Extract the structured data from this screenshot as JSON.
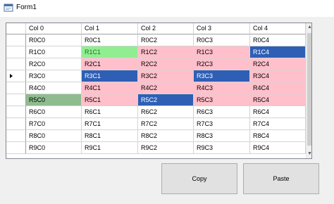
{
  "window": {
    "title": "Form1",
    "icon": "winforms-app-icon"
  },
  "grid": {
    "columns": [
      "Col 0",
      "Col 1",
      "Col 2",
      "Col 3",
      "Col 4"
    ],
    "current_row_indicator": "row-pointer-arrow",
    "current_row_index": 3,
    "rows": [
      [
        "R0C0",
        "R0C1",
        "R0C2",
        "R0C3",
        "R0C4"
      ],
      [
        "R1C0",
        "R1C1",
        "R1C2",
        "R1C3",
        "R1C4"
      ],
      [
        "R2C0",
        "R2C1",
        "R2C2",
        "R2C3",
        "R2C4"
      ],
      [
        "R3C0",
        "R3C1",
        "R3C2",
        "R3C3",
        "R3C4"
      ],
      [
        "R4C0",
        "R4C1",
        "R4C2",
        "R4C3",
        "R4C4"
      ],
      [
        "R5C0",
        "R5C1",
        "R5C2",
        "R5C3",
        "R5C4"
      ],
      [
        "R6C0",
        "R6C1",
        "R6C2",
        "R6C3",
        "R6C4"
      ],
      [
        "R7C0",
        "R7C1",
        "R7C2",
        "R7C3",
        "R7C4"
      ],
      [
        "R8C0",
        "R8C1",
        "R8C2",
        "R8C3",
        "R8C4"
      ],
      [
        "R9C0",
        "R9C1",
        "R9C2",
        "R9C3",
        "R9C4"
      ]
    ],
    "cell_colors": [
      [
        "white",
        "white",
        "white",
        "white",
        "white"
      ],
      [
        "white",
        "green",
        "pink",
        "pink",
        "blue"
      ],
      [
        "white",
        "pink",
        "pink",
        "pink",
        "pink"
      ],
      [
        "white",
        "blue",
        "pink",
        "blue",
        "pink"
      ],
      [
        "white",
        "pink",
        "pink",
        "pink",
        "pink"
      ],
      [
        "dkgreen",
        "pink",
        "blue",
        "pink",
        "pink"
      ],
      [
        "white",
        "white",
        "white",
        "white",
        "white"
      ],
      [
        "white",
        "white",
        "white",
        "white",
        "white"
      ],
      [
        "white",
        "white",
        "white",
        "white",
        "white"
      ],
      [
        "white",
        "white",
        "white",
        "white",
        "white"
      ]
    ],
    "colors": {
      "white": "#ffffff",
      "pink": "#ffc0cb",
      "green": "#90ee90",
      "dkgreen": "#8fbc8f",
      "blue": "#2e5fb5"
    }
  },
  "buttons": {
    "copy_label": "Copy",
    "paste_label": "Paste"
  }
}
